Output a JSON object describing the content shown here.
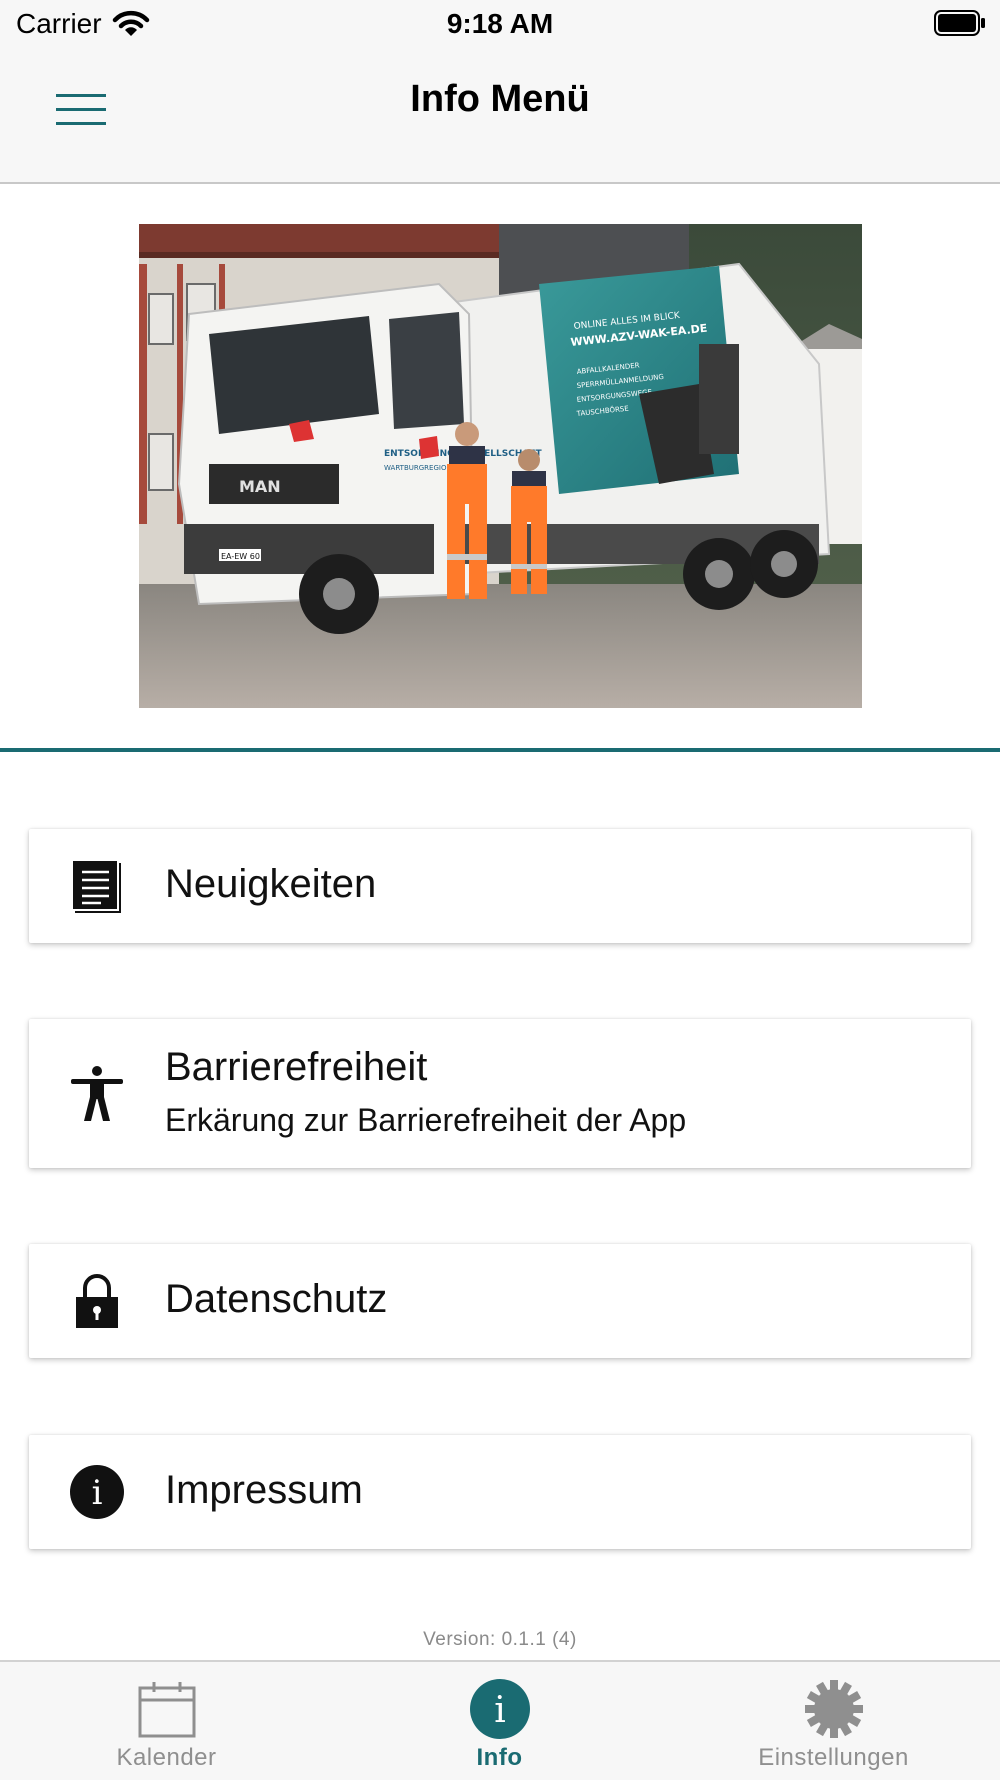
{
  "status_bar": {
    "carrier": "Carrier",
    "time": "9:18 AM"
  },
  "header": {
    "title": "Info Menü",
    "menu_icon": "hamburger-menu-icon"
  },
  "hero": {
    "truck_text_company": "ENTSORGUNGS GESELLSCHAFT",
    "truck_text_region": "WARTBURGREGION",
    "truck_url": "WWW.AZV-WAK-EA.DE",
    "truck_slogan": "ONLINE ALLES IM BLICK",
    "truck_list": [
      "ABFALLKALENDER",
      "SPERRMÜLLANMELDUNG",
      "ENTSORGUNGSWEGE",
      "TAUSCHBÖRSE"
    ],
    "grille_brand": "MAN",
    "plate": "EA-EW 60"
  },
  "accent_color": "#1a6b72",
  "menu_items": [
    {
      "icon": "document-icon",
      "title": "Neuigkeiten",
      "subtitle": ""
    },
    {
      "icon": "accessibility-icon",
      "title": "Barrierefreiheit",
      "subtitle": "Erkärung zur Barrierefreiheit der App"
    },
    {
      "icon": "lock-icon",
      "title": "Datenschutz",
      "subtitle": ""
    },
    {
      "icon": "info-icon",
      "title": "Impressum",
      "subtitle": ""
    }
  ],
  "version": "Version: 0.1.1 (4)",
  "tabs": [
    {
      "label": "Kalender",
      "icon": "calendar-icon",
      "active": false
    },
    {
      "label": "Info",
      "icon": "info-icon",
      "active": true
    },
    {
      "label": "Einstellungen",
      "icon": "gear-icon",
      "active": false
    }
  ]
}
